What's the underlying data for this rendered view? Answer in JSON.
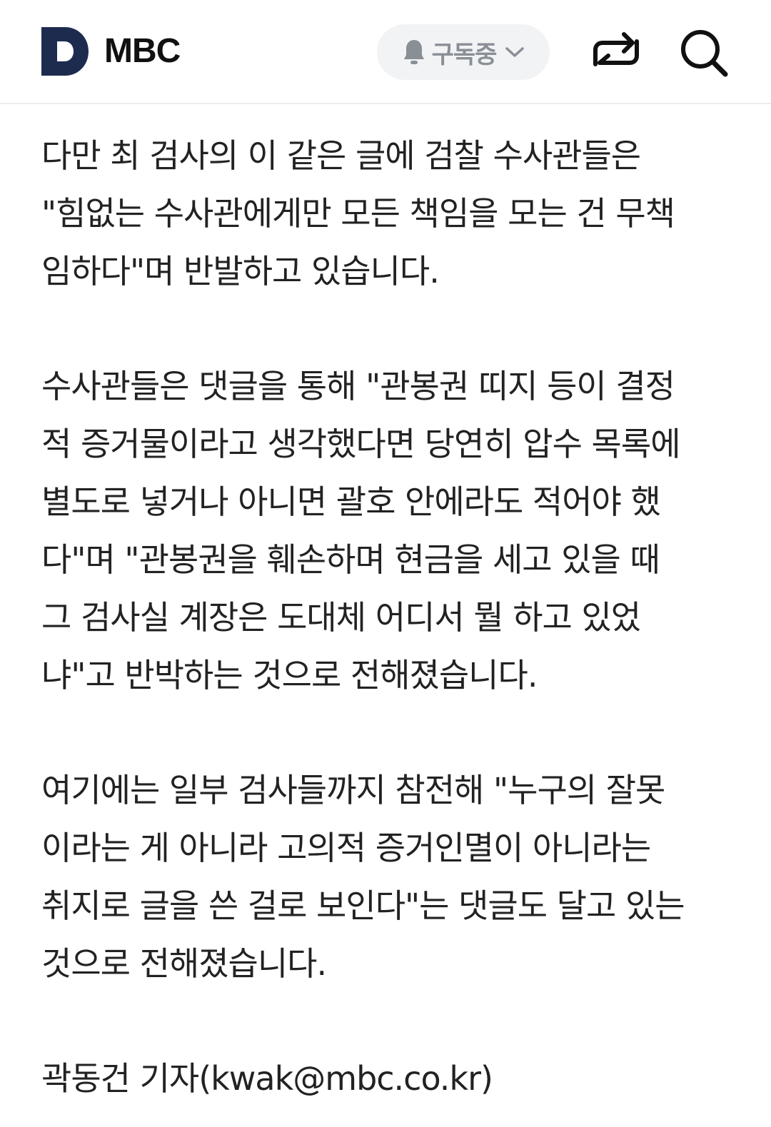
{
  "header": {
    "logo_icon": "daum-d-logo-icon",
    "press_name": "MBC",
    "subscribe": {
      "label": "구독중",
      "icon": "bell-icon",
      "dropdown_icon": "chevron-down-icon"
    },
    "share_icon": "share-icon",
    "search_icon": "search-icon"
  },
  "article": {
    "paragraphs": [
      {
        "lines": [
          "다만 최 검사의 이 같은 글에 검찰 수사관들은",
          "\"힘없는 수사관에게만 모든 책임을 모는 건 무책",
          "임하다\"며 반발하고 있습니다."
        ]
      },
      {
        "lines": [
          "수사관들은 댓글을 통해 \"관봉권 띠지 등이 결정",
          "적 증거물이라고 생각했다면 당연히 압수 목록에",
          "별도로 넣거나 아니면 괄호 안에라도 적어야 했",
          "다\"며 \"관봉권을 훼손하며 현금을 세고 있을 때",
          "그 검사실 계장은 도대체 어디서 뭘 하고 있었",
          "냐\"고 반박하는 것으로 전해졌습니다."
        ]
      },
      {
        "lines": [
          "여기에는 일부 검사들까지 참전해 \"누구의 잘못",
          "이라는 게 아니라 고의적 증거인멸이 아니라는",
          "취지로 글을 쓴 걸로 보인다\"는 댓글도 달고 있는",
          "것으로 전해졌습니다."
        ]
      }
    ],
    "byline": "곽동건 기자(kwak@mbc.co.kr)"
  },
  "colors": {
    "logo": "#1d2b4f",
    "text": "#222222",
    "subscribe_bg": "#f1f3f5",
    "subscribe_text": "#8a8f96",
    "divider": "#ececec"
  }
}
